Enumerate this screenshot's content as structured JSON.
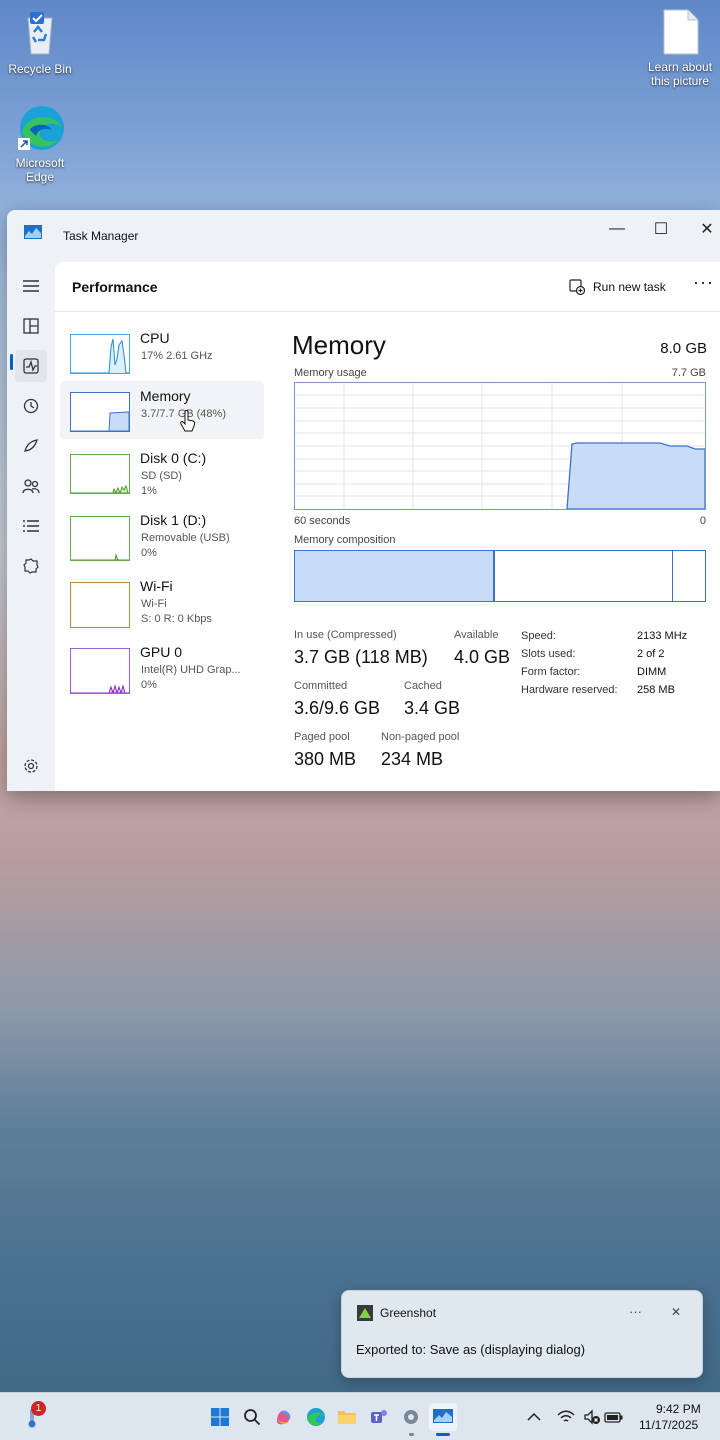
{
  "desktop": {
    "recycle_bin": "Recycle Bin",
    "edge_line1": "Microsoft",
    "edge_line2": "Edge",
    "learn_line1": "Learn about",
    "learn_line2": "this picture"
  },
  "window": {
    "title": "Task Manager",
    "minimize": "—",
    "maximize": "☐",
    "close": "✕"
  },
  "header": {
    "page_title": "Performance",
    "run_new_task": "Run new task",
    "more": "···"
  },
  "perf_list": [
    {
      "name": "CPU",
      "sub1": "17% 2.61 GHz",
      "sub2": ""
    },
    {
      "name": "Memory",
      "sub1": "3.7/7.7 GB (48%)",
      "sub2": ""
    },
    {
      "name": "Disk 0 (C:)",
      "sub1": "SD (SD)",
      "sub2": "1%"
    },
    {
      "name": "Disk 1 (D:)",
      "sub1": "Removable (USB)",
      "sub2": "0%"
    },
    {
      "name": "Wi-Fi",
      "sub1": "Wi-Fi",
      "sub2": "S: 0 R: 0 Kbps"
    },
    {
      "name": "GPU 0",
      "sub1": "Intel(R) UHD Grap...",
      "sub2": "0%"
    }
  ],
  "memory": {
    "title": "Memory",
    "total": "8.0 GB",
    "usage_label": "Memory usage",
    "usage_max": "7.7 GB",
    "time_left": "60 seconds",
    "time_right": "0",
    "composition_label": "Memory composition",
    "composition": {
      "in_use_fraction": 0.485,
      "modified_fraction": 0.0,
      "standby_fraction": 0.435,
      "free_fraction": 0.08
    },
    "stats": {
      "in_use_label": "In use (Compressed)",
      "in_use_value": "3.7 GB (118 MB)",
      "available_label": "Available",
      "available_value": "4.0 GB",
      "committed_label": "Committed",
      "committed_value": "3.6/9.6 GB",
      "cached_label": "Cached",
      "cached_value": "3.4 GB",
      "paged_label": "Paged pool",
      "paged_value": "380 MB",
      "nonpaged_label": "Non-paged pool",
      "nonpaged_value": "234 MB"
    },
    "specs": {
      "speed_label": "Speed:",
      "speed_value": "2133 MHz",
      "slots_label": "Slots used:",
      "slots_value": "2 of 2",
      "form_label": "Form factor:",
      "form_value": "DIMM",
      "hw_label": "Hardware reserved:",
      "hw_value": "258 MB"
    }
  },
  "toast": {
    "app": "Greenshot",
    "message": "Exported to: Save as (displaying dialog)",
    "more": "···",
    "close": "✕"
  },
  "taskbar": {
    "time": "9:42 PM",
    "date": "11/17/2025",
    "badge": "1"
  },
  "colors": {
    "accent": "#0a5fc6",
    "memory_fill": "#c9dcf7",
    "memory_stroke": "#3c73c4",
    "cpu_stroke": "#1d8cd6",
    "disk_stroke": "#4e9a2d",
    "gpu_stroke": "#8a2bb8"
  }
}
